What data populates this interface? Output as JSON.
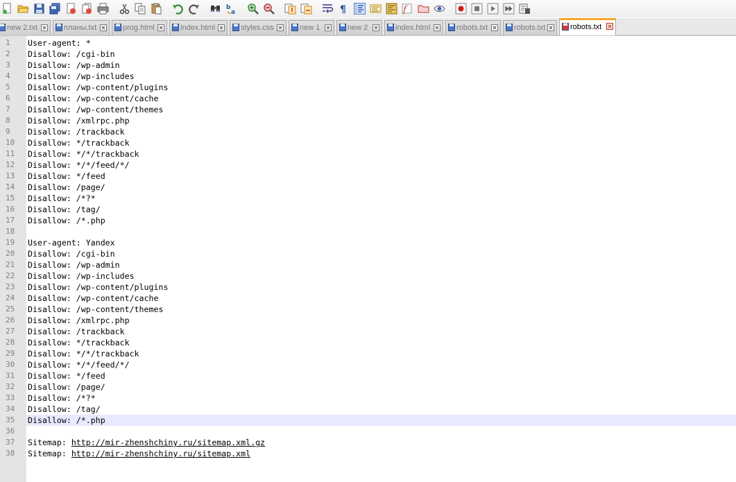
{
  "toolbar": {
    "buttons": [
      {
        "icon": "new-file-icon",
        "sep": false
      },
      {
        "icon": "open-file-icon",
        "sep": false
      },
      {
        "icon": "save-icon",
        "sep": false
      },
      {
        "icon": "save-all-icon",
        "sep": false
      },
      {
        "icon": "close-file-icon",
        "sep": false
      },
      {
        "icon": "close-all-icon",
        "sep": false
      },
      {
        "icon": "print-icon",
        "sep": true
      },
      {
        "icon": "cut-icon",
        "sep": false
      },
      {
        "icon": "copy-icon",
        "sep": false
      },
      {
        "icon": "paste-icon",
        "sep": true
      },
      {
        "icon": "undo-icon",
        "sep": false
      },
      {
        "icon": "redo-icon",
        "sep": true
      },
      {
        "icon": "find-icon",
        "sep": false
      },
      {
        "icon": "replace-icon",
        "sep": true
      },
      {
        "icon": "zoom-in-icon",
        "sep": false
      },
      {
        "icon": "zoom-out-icon",
        "sep": true
      },
      {
        "icon": "sync-vertical-icon",
        "sep": false
      },
      {
        "icon": "sync-horizontal-icon",
        "sep": true
      },
      {
        "icon": "word-wrap-icon",
        "sep": false
      },
      {
        "icon": "show-all-chars-icon",
        "sep": false
      },
      {
        "icon": "indent-guide-icon",
        "sep": false
      },
      {
        "icon": "language-icon",
        "sep": false
      },
      {
        "icon": "document-map-icon",
        "sep": false
      },
      {
        "icon": "function-list-icon",
        "sep": false
      },
      {
        "icon": "folder-workspace-icon",
        "sep": false
      },
      {
        "icon": "monitoring-icon",
        "sep": true
      },
      {
        "icon": "record-macro-icon",
        "sep": false
      },
      {
        "icon": "stop-macro-icon",
        "sep": false
      },
      {
        "icon": "play-macro-icon",
        "sep": false
      },
      {
        "icon": "run-macro-multiple-icon",
        "sep": false
      },
      {
        "icon": "save-macro-icon",
        "sep": false
      }
    ]
  },
  "tabs": [
    {
      "label": "new 2.txt",
      "type": "txt",
      "active": false
    },
    {
      "label": "планы.txt",
      "type": "txt",
      "active": false
    },
    {
      "label": "prog.html",
      "type": "html",
      "active": false
    },
    {
      "label": "index.html",
      "type": "html",
      "active": false
    },
    {
      "label": "styles.css",
      "type": "css",
      "active": false
    },
    {
      "label": "new 1",
      "type": "txt",
      "active": false
    },
    {
      "label": "new 2",
      "type": "txt",
      "active": false
    },
    {
      "label": "index.html",
      "type": "html",
      "active": false
    },
    {
      "label": "robots.txt",
      "type": "txt",
      "active": false
    },
    {
      "label": "robots.txt",
      "type": "txt",
      "active": false
    },
    {
      "label": "robots.txt",
      "type": "txt",
      "active": true
    }
  ],
  "editor": {
    "current_line": 35,
    "lines": [
      "User-agent: *",
      "Disallow: /cgi-bin",
      "Disallow: /wp-admin",
      "Disallow: /wp-includes",
      "Disallow: /wp-content/plugins",
      "Disallow: /wp-content/cache",
      "Disallow: /wp-content/themes",
      "Disallow: /xmlrpc.php",
      "Disallow: /trackback",
      "Disallow: */trackback",
      "Disallow: */*/trackback",
      "Disallow: */*/feed/*/",
      "Disallow: */feed",
      "Disallow: /page/",
      "Disallow: /*?*",
      "Disallow: /tag/",
      "Disallow: /*.php",
      "",
      "User-agent: Yandex",
      "Disallow: /cgi-bin",
      "Disallow: /wp-admin",
      "Disallow: /wp-includes",
      "Disallow: /wp-content/plugins",
      "Disallow: /wp-content/cache",
      "Disallow: /wp-content/themes",
      "Disallow: /xmlrpc.php",
      "Disallow: /trackback",
      "Disallow: */trackback",
      "Disallow: */*/trackback",
      "Disallow: */*/feed/*/",
      "Disallow: */feed",
      "Disallow: /page/",
      "Disallow: /*?*",
      "Disallow: /tag/",
      "Disallow: /*.php",
      "",
      "Sitemap: http://mir-zhenshchiny.ru/sitemap.xml.gz",
      "Sitemap: http://mir-zhenshchiny.ru/sitemap.xml"
    ]
  },
  "colors": {
    "accent_active_tab": "#f6a628",
    "current_line": "#e8e8ff",
    "gutter": "#e4e4e4"
  }
}
